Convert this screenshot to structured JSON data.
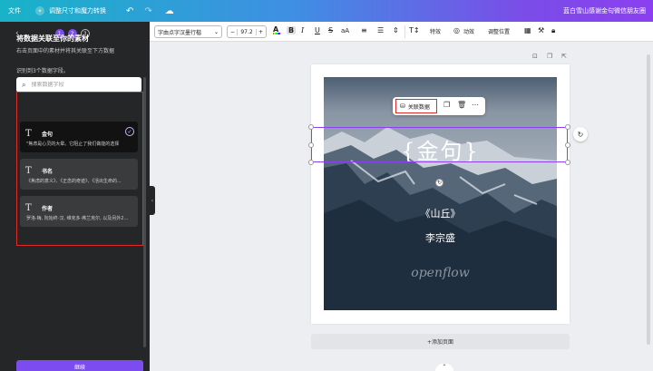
{
  "topbar": {
    "menu_label": "文件",
    "magic_label": "调整尺寸和魔力转换",
    "undo_icon": "undo-icon",
    "redo_icon": "redo-icon",
    "cloud_icon": "cloud-save-icon",
    "doc_title": "蓝白雪山感谢金句微信朋友圈"
  },
  "left_panel": {
    "steps": [
      "1",
      "2",
      "3"
    ],
    "active_steps": 2,
    "title": "将数据关联至你的素材",
    "subtitle": "右击页面中的素材并将其关联至下方数据",
    "found_text": "识别到3个数据字段。",
    "search_placeholder": "搜索数据字段",
    "fields": [
      {
        "icon": "T",
        "name": "金句",
        "preview": "\"焦虑是心灵的大晕。它阻止了我们做能的选择",
        "selected": true
      },
      {
        "icon": "T",
        "name": "书名",
        "preview": "《焦虑的意义》、《正念的奇迹》、《活出生命的...",
        "selected": false
      },
      {
        "icon": "T",
        "name": "作者",
        "preview": "罗洛·梅, 阮始终·汉, 维克多·弗兰克尔, 以及另外2...",
        "selected": false
      }
    ],
    "continue_label": "继续"
  },
  "toolbar": {
    "font_name": "字由点字汉墨行楷",
    "minus": "−",
    "font_size": "97.2",
    "plus": "+",
    "color_label": "A",
    "bold": "B",
    "italic": "I",
    "underline": "U",
    "strike": "S",
    "case": "aA",
    "effects_label": "特效",
    "animate_label": "动效",
    "position_label": "调整位置"
  },
  "canvas": {
    "jinju_text": "{金句}",
    "book_text": "《山丘》",
    "author_text": "李宗盛",
    "watermark": "openflow",
    "link_data_label": "关联数据",
    "add_page_label": "+添加页面"
  },
  "colors": {
    "accent": "#7d4cf0",
    "highlight_red": "#e02a2a",
    "panel_bg": "#252627"
  }
}
